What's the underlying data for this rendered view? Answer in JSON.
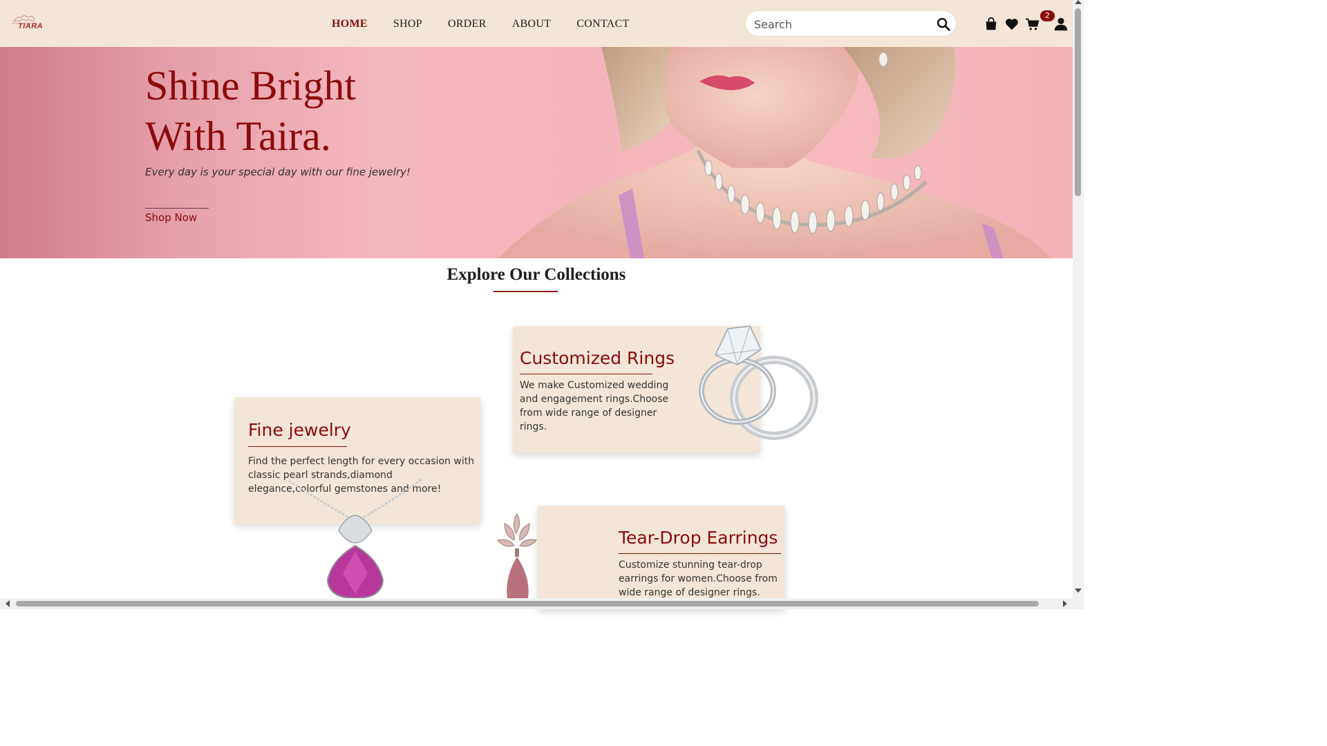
{
  "brand": {
    "logo_text": "TIARA",
    "accent": "#8b0a0a",
    "header_bg": "#f3e6d8"
  },
  "nav": {
    "items": [
      {
        "label": "HOME",
        "active": true
      },
      {
        "label": "SHOP",
        "active": false
      },
      {
        "label": "ORDER",
        "active": false
      },
      {
        "label": "ABOUT",
        "active": false
      },
      {
        "label": "CONTACT",
        "active": false
      }
    ]
  },
  "search": {
    "placeholder": "Search",
    "icon": "search-icon"
  },
  "header_icons": {
    "bag": "shopping-bag-icon",
    "wishlist": "heart-icon",
    "cart": "cart-icon",
    "cart_count": "2",
    "account": "user-icon"
  },
  "hero": {
    "title_line1": "Shine Bright",
    "title_line2": "With Taira.",
    "subtitle": "Every day is your special day with our fine jewelry!",
    "cta": "Shop Now"
  },
  "collections": {
    "title": "Explore Our Collections",
    "cards": {
      "rings": {
        "title": "Customized Rings",
        "text": "We make Customized wedding and engagement rings.Choose from wide range of designer rings."
      },
      "fine": {
        "title": "Fine jewelry",
        "text": "Find the perfect length for every occasion with classic pearl strands,diamond elegance,colorful gemstones and more!"
      },
      "earrings": {
        "title": "Tear-Drop Earrings",
        "text": "Customize stunning tear-drop earrings for women.Choose from wide range of designer rings."
      }
    }
  }
}
